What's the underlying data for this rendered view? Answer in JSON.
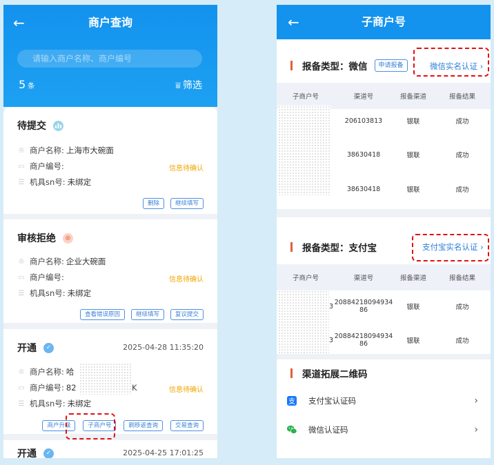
{
  "left": {
    "title": "商户查询",
    "back": "←",
    "search_placeholder": "请输入商户名称、商户编号",
    "count": "5",
    "count_unit": "条",
    "filter_icon": "⩸",
    "filter_label": "筛选",
    "field_labels": {
      "name": "商户名称:",
      "no": "商户编号:",
      "sn": "机具sn号:"
    },
    "cards": [
      {
        "status": "待提交",
        "name": "上海市大碗面",
        "no": "",
        "sn": "未绑定",
        "warn": "信息待确认",
        "buttons": [
          "删除",
          "继续填写"
        ]
      },
      {
        "status": "审核拒绝",
        "name": "企业大碗面",
        "no": "",
        "sn": "未绑定",
        "warn": "信息待确认",
        "buttons": [
          "查看错误原因",
          "继续填写",
          "复议提交"
        ]
      },
      {
        "status": "开通",
        "time": "2025-04-28 11:35:20",
        "name": "哈",
        "no": "82",
        "no_tail": "K",
        "sn": "未绑定",
        "warn": "信息待确认",
        "buttons": [
          "商户升级",
          "子商户号",
          "刷移返查询",
          "交易查询"
        ]
      },
      {
        "status": "开通",
        "time": "2025-04-25 17:01:25"
      }
    ]
  },
  "right": {
    "title": "子商户号",
    "back": "←",
    "wechat": {
      "title": "报备类型：微信",
      "apply": "申请报备",
      "link": "微信实名认证",
      "headers": [
        "子商户号",
        "渠道号",
        "报备渠道",
        "报备结果"
      ],
      "rows": [
        {
          "channel_no": "206103813",
          "channel": "银联",
          "result": "成功"
        },
        {
          "channel_no": "38630418",
          "channel": "银联",
          "result": "成功"
        },
        {
          "channel_no": "38630418",
          "channel": "银联",
          "result": "成功"
        }
      ]
    },
    "alipay": {
      "title": "报备类型：支付宝",
      "link": "支付宝实名认证",
      "headers": [
        "子商户号",
        "渠道号",
        "报备渠道",
        "报备结果"
      ],
      "rows": [
        {
          "prefix": "3",
          "channel_no_1": "20884218094934",
          "channel_no_2": "86",
          "channel": "银联",
          "result": "成功"
        },
        {
          "prefix": "3",
          "channel_no_1": "20884218094934",
          "channel_no_2": "86",
          "channel": "银联",
          "result": "成功"
        }
      ]
    },
    "qr": {
      "title": "渠道拓展二维码",
      "items": [
        {
          "label": "支付宝认证码",
          "icon": "alipay-icon"
        },
        {
          "label": "微信认证码",
          "icon": "wechat-icon"
        }
      ]
    }
  },
  "colors": {
    "primary": "#1392ee",
    "accent_bar": "#e0603a",
    "warn": "#f2a600",
    "link": "#2a7fd8",
    "highlight": "#e01010"
  }
}
